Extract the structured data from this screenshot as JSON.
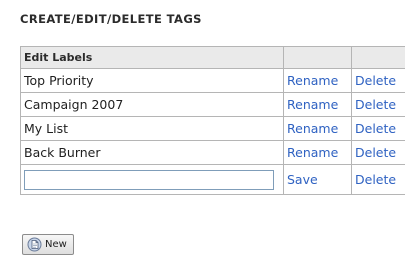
{
  "panel": {
    "title": "CREATE/EDIT/DELETE TAGS"
  },
  "table": {
    "header": {
      "name": "Edit Labels",
      "action1": "",
      "action2": ""
    },
    "rows": [
      {
        "label": "Top Priority",
        "rename": "Rename",
        "delete": "Delete"
      },
      {
        "label": "Campaign 2007",
        "rename": "Rename",
        "delete": "Delete"
      },
      {
        "label": "My List",
        "rename": "Rename",
        "delete": "Delete"
      },
      {
        "label": "Back Burner",
        "rename": "Rename",
        "delete": "Delete"
      }
    ],
    "new_row": {
      "value": "",
      "save": "Save",
      "delete": "Delete"
    }
  },
  "new_button": {
    "label": "New",
    "icon": "document-icon"
  },
  "colors": {
    "link": "#2f62c2",
    "header_bg": "#eaeaea",
    "border": "#b5b5b5"
  }
}
